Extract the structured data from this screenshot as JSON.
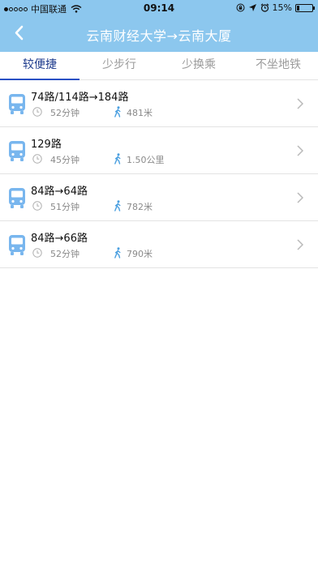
{
  "status_bar": {
    "carrier": "中国联通",
    "time": "09:14",
    "battery": "15%",
    "battery_level": 0.15,
    "signal_bars_filled": 1,
    "signal_bars_total": 5
  },
  "nav": {
    "title": "云南财经大学→云南大厦",
    "back_icon": "chevron-left-icon"
  },
  "tabs": [
    {
      "label": "较便捷",
      "active": true
    },
    {
      "label": "少步行",
      "active": false
    },
    {
      "label": "少换乘",
      "active": false
    },
    {
      "label": "不坐地铁",
      "active": false
    }
  ],
  "routes": [
    {
      "name": "74路/114路→184路",
      "duration": "52分钟",
      "walk": "481米"
    },
    {
      "name": "129路",
      "duration": "45分钟",
      "walk": "1.50公里"
    },
    {
      "name": "84路→64路",
      "duration": "51分钟",
      "walk": "782米"
    },
    {
      "name": "84路→66路",
      "duration": "52分钟",
      "walk": "790米"
    }
  ],
  "colors": {
    "header": "#8cc7ee",
    "tab_active": "#1d3a8c",
    "tab_underline": "#2a50c4",
    "bus_icon": "#78b6ee",
    "walk_icon": "#4a9fe0"
  }
}
